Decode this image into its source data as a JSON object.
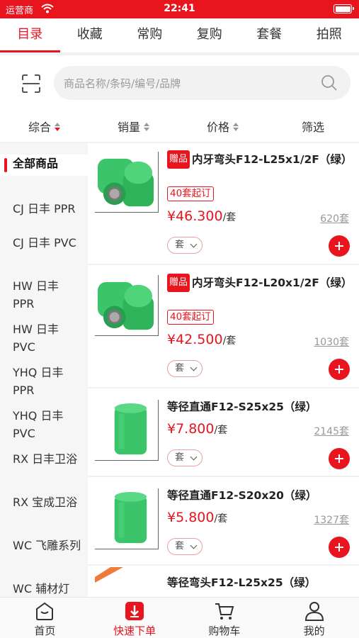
{
  "status_bar": {
    "carrier": "运营商",
    "time": "22:41"
  },
  "top_tabs": [
    {
      "label": "目录",
      "active": true
    },
    {
      "label": "收藏"
    },
    {
      "label": "常购"
    },
    {
      "label": "复购"
    },
    {
      "label": "套餐"
    },
    {
      "label": "拍照"
    }
  ],
  "search": {
    "placeholder": "商品名称/条码/编号/品牌"
  },
  "sort": {
    "comprehensive": "综合",
    "sales": "销量",
    "price": "价格",
    "filter": "筛选"
  },
  "categories": [
    {
      "label": "全部商品",
      "active": true
    },
    {
      "label": "CJ 日丰 PPR"
    },
    {
      "label": "CJ 日丰 PVC"
    },
    {
      "label": "HW 日丰 PPR"
    },
    {
      "label": "HW 日丰 PVC"
    },
    {
      "label": "YHQ 日丰 PPR"
    },
    {
      "label": "YHQ 日丰 PVC"
    },
    {
      "label": "RX 日丰卫浴"
    },
    {
      "label": "RX 宝成卫浴"
    },
    {
      "label": "WC 飞雕系列"
    },
    {
      "label": "WC 辅材灯"
    }
  ],
  "products": [
    {
      "gift_badge": "赠品",
      "title": "内牙弯头F12-L25x1/2F（绿）",
      "moq": "40套起订",
      "price": "¥46.300",
      "unit": "/套",
      "stock": "620套",
      "unit_select": "套"
    },
    {
      "gift_badge": "赠品",
      "title": "内牙弯头F12-L20x1/2F（绿）",
      "moq": "40套起订",
      "price": "¥42.500",
      "unit": "/套",
      "stock": "1030套",
      "unit_select": "套"
    },
    {
      "title": "等径直通F12-S25x25（绿）",
      "price": "¥7.800",
      "unit": "/套",
      "stock": "2145套",
      "unit_select": "套"
    },
    {
      "title": "等径直通F12-S20x20（绿）",
      "price": "¥5.800",
      "unit": "/套",
      "stock": "1327套",
      "unit_select": "套"
    },
    {
      "title": "等径弯头F12-L25x25（绿）"
    }
  ],
  "bottom_nav": [
    {
      "label": "首页"
    },
    {
      "label": "快速下单",
      "active": true
    },
    {
      "label": "购物车"
    },
    {
      "label": "我的"
    }
  ],
  "colors": {
    "accent": "#e8141e",
    "product_green": "#3cc46a"
  }
}
